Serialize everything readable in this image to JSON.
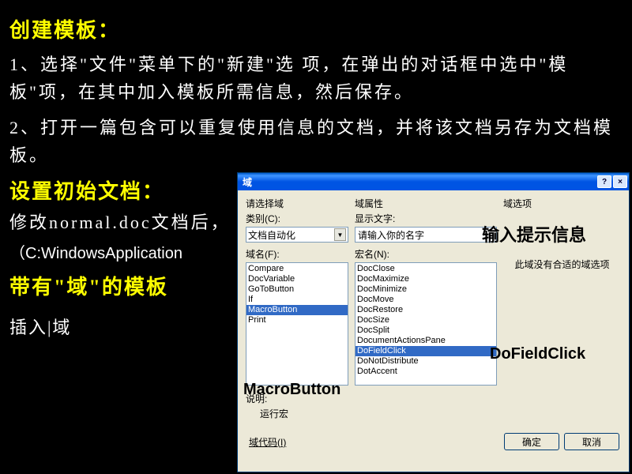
{
  "slide": {
    "title1": "创建模板：",
    "para1": "1、选择\"文件\"菜单下的\"新建\"选 项，在弹出的对话框中选中\"模板\"项，在其中加入模板所需信息，然后保存。",
    "para2": "2、打开一篇包含可以重复使用信息的文档，并将该文档另存为文档模 板。",
    "title2": "设置初始文档：",
    "para3": "修改normal.doc文档后，",
    "path": "（C:WindowsApplication",
    "title3": "带有\"域\"的模板",
    "insert": "插入|域"
  },
  "dialog": {
    "title": "域",
    "select_field": "请选择域",
    "category_label": "类别(C):",
    "category_value": "文档自动化",
    "fieldname_label": "域名(F):",
    "field_items": [
      "Compare",
      "DocVariable",
      "GoToButton",
      "If",
      "MacroButton",
      "Print"
    ],
    "field_selected": "MacroButton",
    "properties_label": "域属性",
    "display_label": "显示文字:",
    "display_value": "请输入你的名字",
    "macroname_label": "宏名(N):",
    "macro_items": [
      "DocClose",
      "DocMaximize",
      "DocMinimize",
      "DocMove",
      "DocRestore",
      "DocSize",
      "DocSplit",
      "DocumentActionsPane",
      "DoFieldClick",
      "DoNotDistribute",
      "DotAccent"
    ],
    "macro_selected": "DoFieldClick",
    "options_label": "域选项",
    "no_options": "此域没有合适的域选项",
    "desc_label": "说明:",
    "desc_text": "运行宏",
    "code_link": "域代码(I)",
    "ok": "确定",
    "cancel": "取消"
  },
  "annotations": {
    "a1": "输入提示信息",
    "a2": "DoFieldClick",
    "a3": "MacroButton"
  }
}
